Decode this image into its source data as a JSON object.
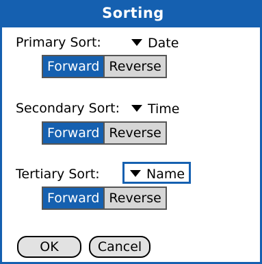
{
  "title": "Sorting",
  "sorts": [
    {
      "label": "Primary Sort:",
      "value": "Date",
      "options": [
        "Forward",
        "Reverse"
      ],
      "selected": "Forward"
    },
    {
      "label": "Secondary Sort:",
      "value": "Time",
      "options": [
        "Forward",
        "Reverse"
      ],
      "selected": "Forward"
    },
    {
      "label": "Tertiary Sort:",
      "value": "Name",
      "options": [
        "Forward",
        "Reverse"
      ],
      "selected": "Forward",
      "focused": true
    }
  ],
  "buttons": {
    "ok": "OK",
    "cancel": "Cancel"
  },
  "colors": {
    "accent": "#1560b0",
    "segment_bg": "#d6d6d6"
  }
}
